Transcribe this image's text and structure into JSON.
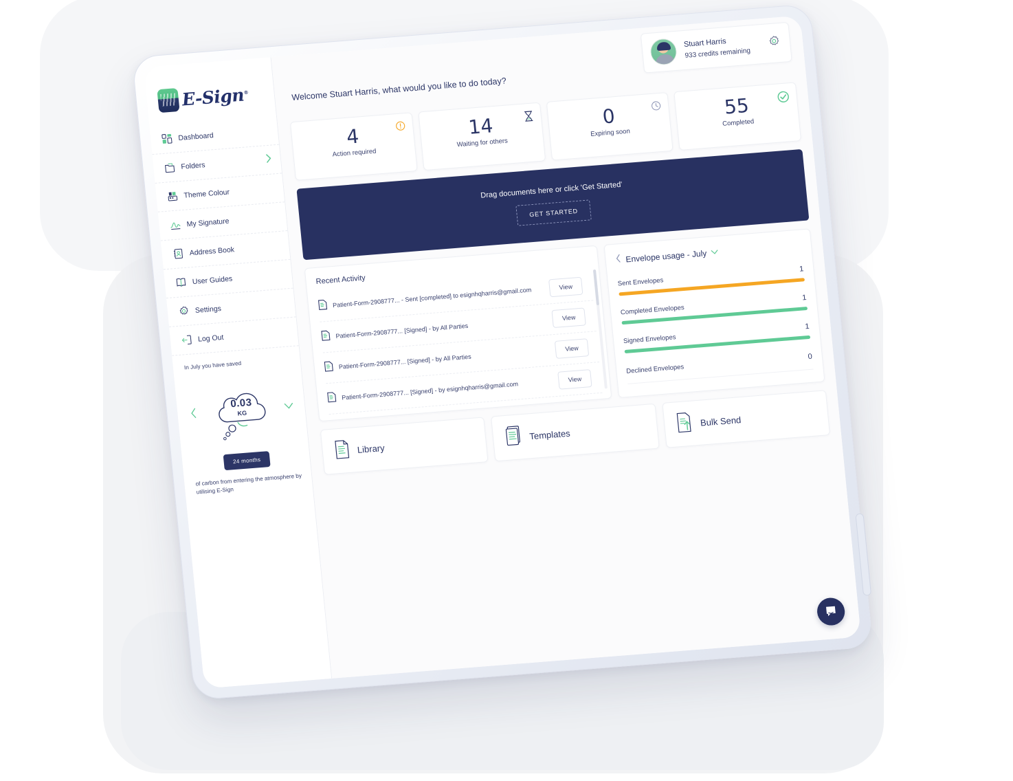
{
  "brand": {
    "logo_text": "E-Sign",
    "logo_tm": "®",
    "accent_green": "#4fbf86",
    "navy": "#283161",
    "orange": "#f5a623"
  },
  "user": {
    "name": "Stuart Harris",
    "credits": "933 credits remaining",
    "gear_icon": "gear-icon",
    "avatar_icon": "avatar"
  },
  "welcome": "Welcome Stuart Harris, what would you like to do today?",
  "sidebar": {
    "items": [
      {
        "label": "Dashboard",
        "icon": "dashboard-icon",
        "chevron": false
      },
      {
        "label": "Folders",
        "icon": "folder-icon",
        "chevron": true
      },
      {
        "label": "Theme Colour",
        "icon": "palette-icon",
        "chevron": false
      },
      {
        "label": "My Signature",
        "icon": "signature-icon",
        "chevron": false
      },
      {
        "label": "Address Book",
        "icon": "address-book-icon",
        "chevron": false
      },
      {
        "label": "User Guides",
        "icon": "book-icon",
        "chevron": false
      },
      {
        "label": "Settings",
        "icon": "gear-icon",
        "chevron": false
      },
      {
        "label": "Log Out",
        "icon": "logout-icon",
        "chevron": false
      }
    ]
  },
  "carbon": {
    "intro": "In July you have saved",
    "value": "0.03",
    "unit": "KG",
    "button": "24 months",
    "outro": "of carbon from entering the atmosphere by utilising E-Sign",
    "prev_icon": "chevron-left-icon",
    "next_icon": "chevron-down-icon"
  },
  "stats": [
    {
      "value": "4",
      "label": "Action required",
      "icon": "alert-icon",
      "color": "#f5a623"
    },
    {
      "value": "14",
      "label": "Waiting for others",
      "icon": "hourglass-icon",
      "color": "#4fbf86"
    },
    {
      "value": "0",
      "label": "Expiring soon",
      "icon": "clock-icon",
      "color": "#8b93b4"
    },
    {
      "value": "55",
      "label": "Completed",
      "icon": "check-circle-icon",
      "color": "#4fbf86"
    }
  ],
  "banner": {
    "text": "Drag documents here or click 'Get Started'",
    "button": "GET STARTED"
  },
  "activity": {
    "title": "Recent Activity",
    "view_label": "View",
    "rows": [
      {
        "name": "Patient-Form-2908777... - Sent [completed] to esignhqharris@gmail.com"
      },
      {
        "name": "Patient-Form-2908777... [Signed] - by All Parties"
      },
      {
        "name": "Patient-Form-2908777... [Signed] - by All Parties"
      },
      {
        "name": "Patient-Form-2908777... [Signed] - by esignhqharris@gmail.com"
      }
    ]
  },
  "usage": {
    "title": "Envelope usage - July",
    "prev_icon": "chevron-left-icon",
    "dropdown_icon": "chevron-down-icon",
    "rows": [
      {
        "label": "Sent Envelopes",
        "value": "1",
        "bar": true,
        "color": "#f5a623",
        "pct": 100
      },
      {
        "label": "Completed Envelopes",
        "value": "1",
        "bar": true,
        "color": "#5fca95",
        "pct": 100
      },
      {
        "label": "Signed Envelopes",
        "value": "1",
        "bar": true,
        "color": "#5fca95",
        "pct": 100
      },
      {
        "label": "Declined Envelopes",
        "value": "0",
        "bar": false,
        "color": "#e6e8ee",
        "pct": 0
      }
    ]
  },
  "tiles": [
    {
      "label": "Library",
      "icon": "library-doc-icon"
    },
    {
      "label": "Templates",
      "icon": "templates-icon"
    },
    {
      "label": "Bulk Send",
      "icon": "bulk-send-icon"
    }
  ],
  "chat": {
    "icon": "chat-bubble-icon"
  }
}
